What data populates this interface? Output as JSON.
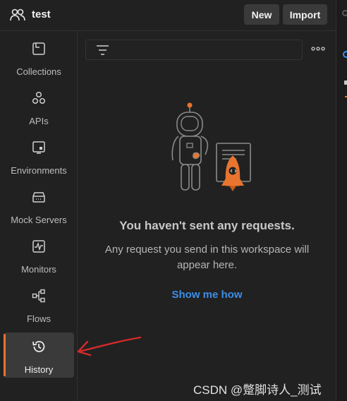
{
  "header": {
    "workspace_icon": "team-users-icon",
    "workspace_name": "test",
    "new_label": "New",
    "import_label": "Import"
  },
  "sidebar": {
    "items": [
      {
        "label": "Collections",
        "icon": "collections-icon",
        "active": false
      },
      {
        "label": "APIs",
        "icon": "apis-icon",
        "active": false
      },
      {
        "label": "Environments",
        "icon": "environments-icon",
        "active": false
      },
      {
        "label": "Mock Servers",
        "icon": "mock-servers-icon",
        "active": false
      },
      {
        "label": "Monitors",
        "icon": "monitors-icon",
        "active": false
      },
      {
        "label": "Flows",
        "icon": "flows-icon",
        "active": false
      },
      {
        "label": "History",
        "icon": "history-icon",
        "active": true
      }
    ]
  },
  "main": {
    "filter_icon": "filter-icon",
    "more_icon": "more-options-icon",
    "empty_title": "You haven't sent any requests.",
    "empty_text": "Any request you send in this workspace will appear here.",
    "show_link": "Show me how"
  },
  "annotation": {
    "arrow_color": "#d42a2a"
  },
  "watermark": "CSDN @蹩脚诗人_测试",
  "colors": {
    "accent_orange": "#e8742f",
    "link_blue": "#3d8ee8",
    "background": "#212121"
  }
}
